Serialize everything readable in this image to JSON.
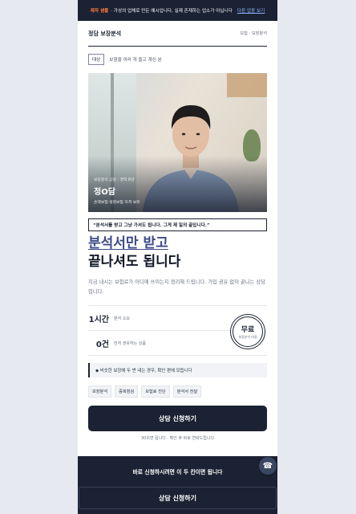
{
  "topbar": {
    "badge": "제작 샘플",
    "text": "· 가상의 업체로 만든 예시입니다, 실제 존재하는 업소가 아닙니다",
    "link": "다른 업종 보기"
  },
  "header": {
    "title": "정담 보장분석",
    "breadcrumb": "보험 · 보장분석"
  },
  "target": {
    "tag": "대상",
    "text": "보험을 여러 개 들고 계신 분"
  },
  "profile": {
    "role": "보장분석 상담 · 경력 8년",
    "name": "정O담",
    "cert": "손해보험·생명보험 자격 보유"
  },
  "quote": "“분석서를 받고 그냥 가셔도 됩니다. 그게 제 일의 끝입니다.”",
  "headline": {
    "line1": "분석서만 받고",
    "line2": "끝나셔도 됩니다"
  },
  "description": "지금 내시는 보험료가 어디에 쓰이는지 정리해 드립니다. 가입 권유 없이 끝나는 상담입니다.",
  "stats": [
    {
      "value": "1시간",
      "label": "분석 소요"
    },
    {
      "value": "0건",
      "label": "먼저 권유하는 상품"
    }
  ],
  "free_badge": {
    "big": "무료",
    "small": "보장분석 비용"
  },
  "notice": "◆ 비슷한 보장에 두 번 내는 경우, 확인 편에 모듭니다",
  "chips": [
    "보장분석",
    "중복점검",
    "보험료 진단",
    "분석서 전달"
  ],
  "cta": {
    "label": "상담 신청하기",
    "note": "30초면 됩니다 · 확인 후 바로 연락드립니다"
  },
  "bottom_bar": {
    "message": "바로 신청하시려면 이 두 칸이면 됩니다",
    "sticky_label": "상담 신청하기",
    "phone_icon": "phone-icon"
  }
}
